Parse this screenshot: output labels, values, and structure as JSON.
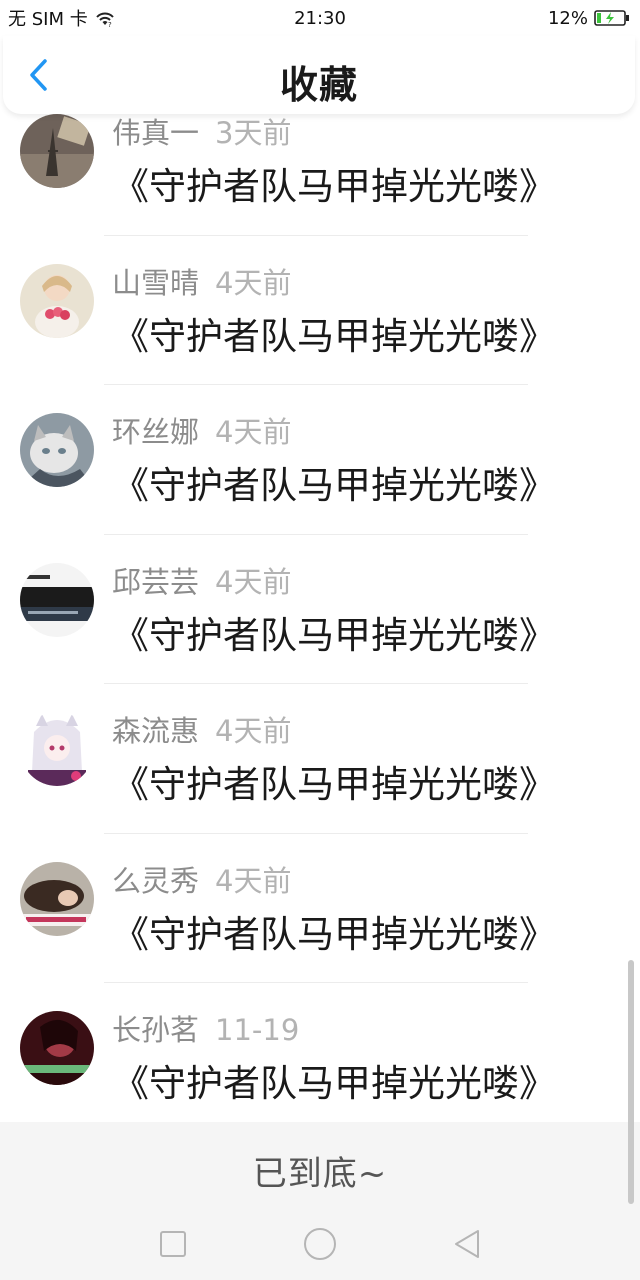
{
  "status_bar": {
    "carrier": "无 SIM 卡",
    "time": "21:30",
    "battery": "12%"
  },
  "header": {
    "title": "收藏"
  },
  "items": [
    {
      "name": "伟真一",
      "time": "3天前",
      "title": "《守护者队马甲掉光光喽》",
      "avatar": "paris-tower-avatar"
    },
    {
      "name": "山雪晴",
      "time": "4天前",
      "title": "《守护者队马甲掉光光喽》",
      "avatar": "doll-avatar"
    },
    {
      "name": "环丝娜",
      "time": "4天前",
      "title": "《守护者队马甲掉光光喽》",
      "avatar": "cat-avatar"
    },
    {
      "name": "邱芸芸",
      "time": "4天前",
      "title": "《守护者队马甲掉光光喽》",
      "avatar": "text-screenshot-avatar"
    },
    {
      "name": "森流惠",
      "time": "4天前",
      "title": "《守护者队马甲掉光光喽》",
      "avatar": "anime-girl-avatar"
    },
    {
      "name": "么灵秀",
      "time": "4天前",
      "title": "《守护者队马甲掉光光喽》",
      "avatar": "lying-girl-avatar"
    },
    {
      "name": "长孙茗",
      "time": "11-19",
      "title": "《守护者队马甲掉光光喽》",
      "avatar": "dark-portrait-avatar"
    }
  ],
  "footer": {
    "end_text": "已到底~"
  },
  "colors": {
    "accent": "#2196f3",
    "name": "#8c8c8c",
    "time": "#b3b3b3"
  }
}
